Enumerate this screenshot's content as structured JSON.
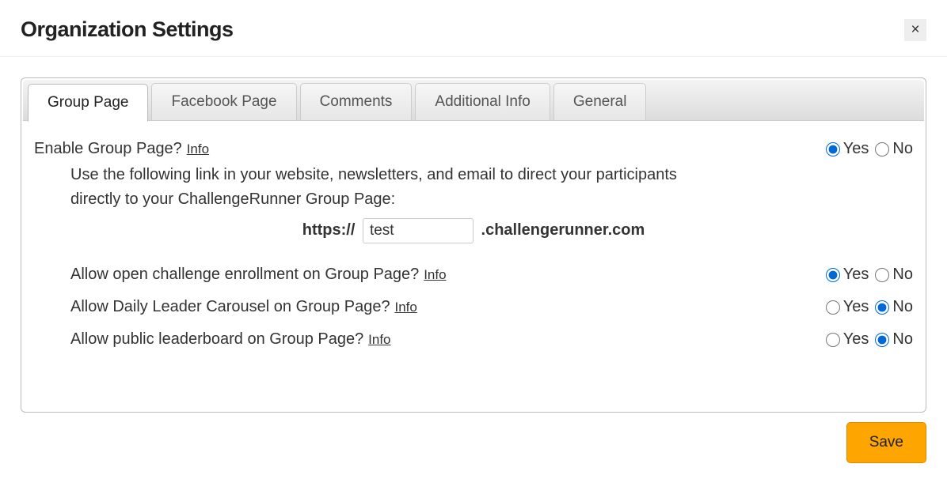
{
  "header": {
    "title": "Organization Settings",
    "close": "×"
  },
  "tabs": {
    "group_page": "Group Page",
    "facebook_page": "Facebook Page",
    "comments": "Comments",
    "additional_info": "Additional Info",
    "general": "General"
  },
  "labels": {
    "yes": "Yes",
    "no": "No",
    "info": "Info"
  },
  "settings": {
    "enable_group_page": {
      "label": "Enable Group Page?",
      "value": "yes",
      "description": "Use the following link in your website, newsletters, and email to direct your participants directly to your ChallengeRunner Group Page:"
    },
    "url": {
      "prefix": "https://",
      "value": "test",
      "suffix": ".challengerunner.com"
    },
    "open_enrollment": {
      "label": "Allow open challenge enrollment on Group Page?",
      "value": "yes"
    },
    "daily_leader": {
      "label": "Allow Daily Leader Carousel on Group Page?",
      "value": "no"
    },
    "public_leaderboard": {
      "label": "Allow public leaderboard on Group Page?",
      "value": "no"
    }
  },
  "footer": {
    "save": "Save"
  }
}
